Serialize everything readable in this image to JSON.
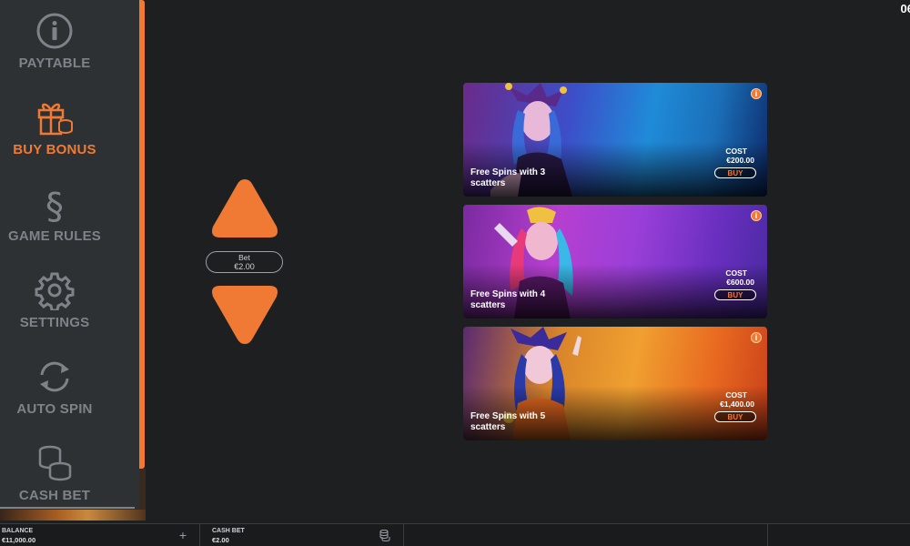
{
  "clock": "06",
  "menu": {
    "items": [
      {
        "label": "PAYTABLE",
        "icon": "info-icon",
        "active": false
      },
      {
        "label": "BUY BONUS",
        "icon": "gift-coins-icon",
        "active": true
      },
      {
        "label": "GAME RULES",
        "icon": "section-sign-icon",
        "active": false
      },
      {
        "label": "SETTINGS",
        "icon": "gear-icon",
        "active": false
      },
      {
        "label": "AUTO SPIN",
        "icon": "refresh-arrows-icon",
        "active": false
      },
      {
        "label": "CASH BET",
        "icon": "coin-stack-icon",
        "active": false
      }
    ]
  },
  "bet": {
    "label": "Bet",
    "value": "€2.00"
  },
  "bonus_cards": [
    {
      "title": "Free Spins with 3 scatters",
      "cost_label": "COST",
      "cost": "€200.00",
      "buy_label": "BUY",
      "info": "i"
    },
    {
      "title": "Free Spins with 4 scatters",
      "cost_label": "COST",
      "cost": "€600.00",
      "buy_label": "BUY",
      "info": "i"
    },
    {
      "title": "Free Spins with 5 scatters",
      "cost_label": "COST",
      "cost": "€1,400.00",
      "buy_label": "BUY",
      "info": "i"
    }
  ],
  "bottom_bar": {
    "balance_label": "BALANCE",
    "balance_value": "€11,000.00",
    "cash_bet_label": "CASH BET",
    "cash_bet_value": "€2.00",
    "plus": "+"
  },
  "colors": {
    "accent": "#f07a33",
    "sidebar_bg": "#2e3134",
    "muted_text": "#7d8389",
    "stage_bg": "#1e1f21"
  }
}
